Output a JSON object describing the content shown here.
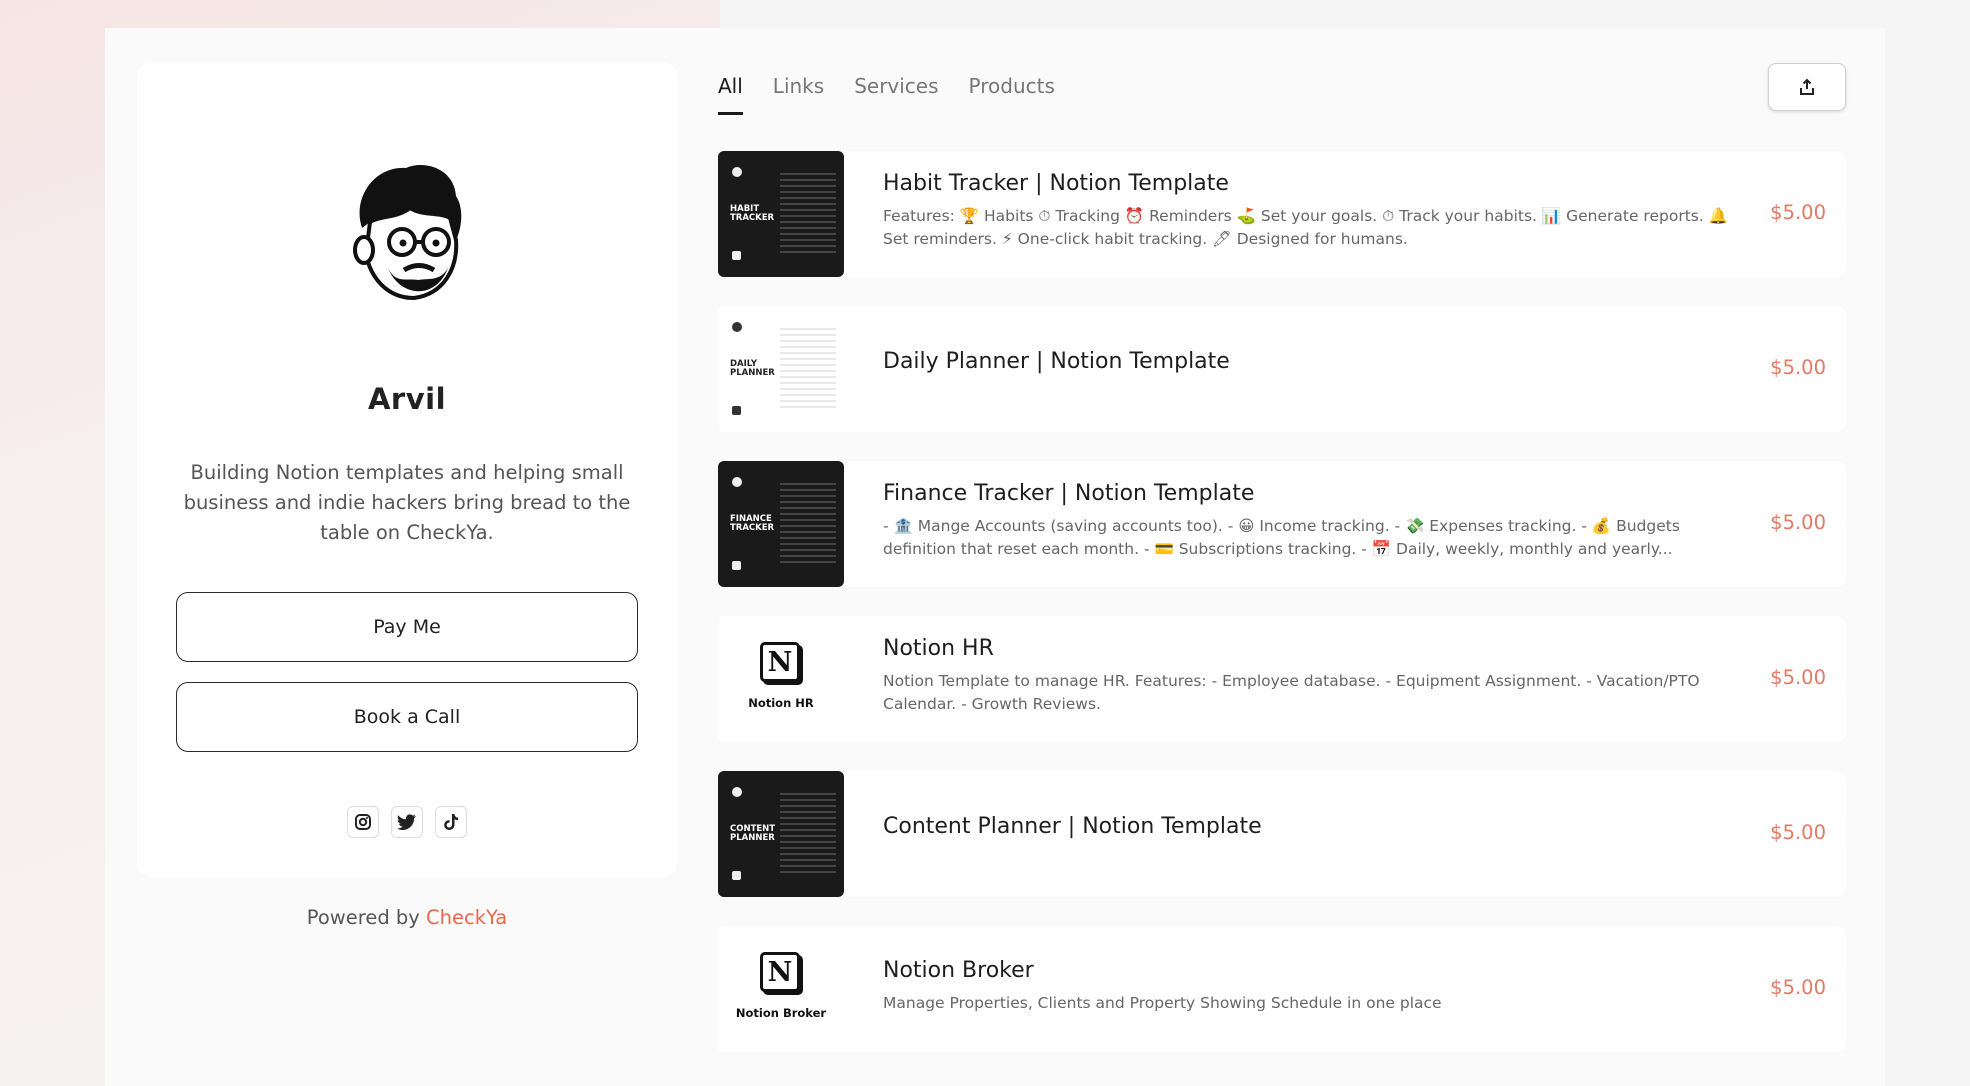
{
  "profile": {
    "name": "Arvil",
    "bio": "Building Notion templates and helping small business and indie hackers bring bread to the table on CheckYa.",
    "buttons": {
      "pay": "Pay Me",
      "call": "Book a Call"
    },
    "socials": [
      "instagram-icon",
      "twitter-icon",
      "tiktok-icon"
    ]
  },
  "footer": {
    "powered_prefix": "Powered by",
    "brand": "CheckYa"
  },
  "tabs": [
    "All",
    "Links",
    "Services",
    "Products"
  ],
  "active_tab": "All",
  "colors": {
    "accent": "#e8684c",
    "price": "#e07a63",
    "text": "#1e1e1e"
  },
  "products": [
    {
      "title": "Habit Tracker | Notion Template",
      "description": "Features: 🏆 Habits ⏱ Tracking ⏰ Reminders ⛳ Set your goals. ⏱ Track your habits. 📊 Generate reports. 🔔 Set reminders. ⚡ One-click habit tracking. 🖊 Designed for humans.",
      "price": "$5.00",
      "thumb_label": "HABIT TRACKER"
    },
    {
      "title": "Daily Planner | Notion Template",
      "description": "",
      "price": "$5.00",
      "thumb_label": "DAILY PLANNER"
    },
    {
      "title": "Finance Tracker | Notion Template",
      "description": "- 🏦 Mange Accounts (saving accounts too). - 😀 Income tracking. - 💸 Expenses tracking. - 💰 Budgets definition that reset each month. - 💳 Subscriptions tracking. - 📅 Daily, weekly, monthly and yearly...",
      "price": "$5.00",
      "thumb_label": "FINANCE TRACKER"
    },
    {
      "title": "Notion HR",
      "description": "Notion Template to manage HR. Features: - Employee database. - Equipment Assignment. - Vacation/PTO Calendar. - Growth Reviews.",
      "price": "$5.00",
      "thumb_label": "Notion HR"
    },
    {
      "title": "Content Planner | Notion Template",
      "description": "",
      "price": "$5.00",
      "thumb_label": "CONTENT PLANNER"
    },
    {
      "title": "Notion Broker",
      "description": "Manage Properties, Clients and Property Showing Schedule in one place",
      "price": "$5.00",
      "thumb_label": "Notion Broker"
    }
  ]
}
